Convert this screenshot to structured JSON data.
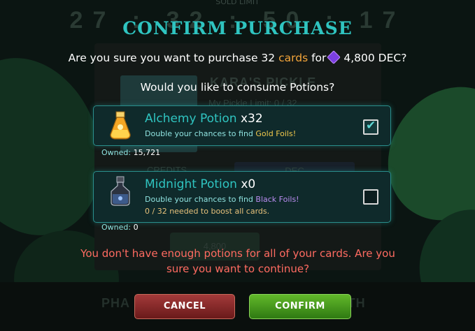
{
  "background": {
    "tag": "SOLD LIMIT",
    "timer": "27 : 32 : 50 : 17",
    "pack_title": "KARA'S PICKLE",
    "pickle_limit": "My Pickle Limit: 0 / 32",
    "credits_tab": "CREDITS",
    "dec_tab": "DEC",
    "price_button": "4,800",
    "phase_left": "PHA",
    "phase_right": "L S     TH"
  },
  "modal": {
    "title": "CONFIRM PURCHASE",
    "question": {
      "prefix": "Are you sure you want to purchase 32",
      "unit": "cards",
      "for": "for",
      "amount": "4,800 DEC?"
    },
    "sub_question": "Would you like to consume Potions?",
    "potions": [
      {
        "name": "Alchemy Potion",
        "qty": "x32",
        "desc_prefix": "Double your chances to find",
        "desc_highlight": "Gold Foils!",
        "checked": true,
        "owned_label": "Owned:",
        "owned_value": "15,721",
        "icon": "gold-potion-icon"
      },
      {
        "name": "Midnight Potion",
        "qty": "x0",
        "desc_prefix": "Double your chances to find",
        "desc_highlight": "Black Foils!",
        "needed": "0 / 32 needed to boost all cards.",
        "checked": false,
        "owned_label": "Owned:",
        "owned_value": "0",
        "icon": "midnight-potion-icon"
      }
    ],
    "warning": "You don't have enough potions for all of your cards. Are you sure you want to continue?",
    "cancel_label": "CANCEL",
    "confirm_label": "CONFIRM"
  },
  "colors": {
    "accent_teal": "#2fc4c0",
    "accent_orange": "#f4a53a",
    "warning_red": "#ff6b61",
    "gold_text": "#f2c94c",
    "black_foil_text": "#b98cf0",
    "cancel_red": "#8a2a2a",
    "confirm_green": "#4a9a1e"
  }
}
